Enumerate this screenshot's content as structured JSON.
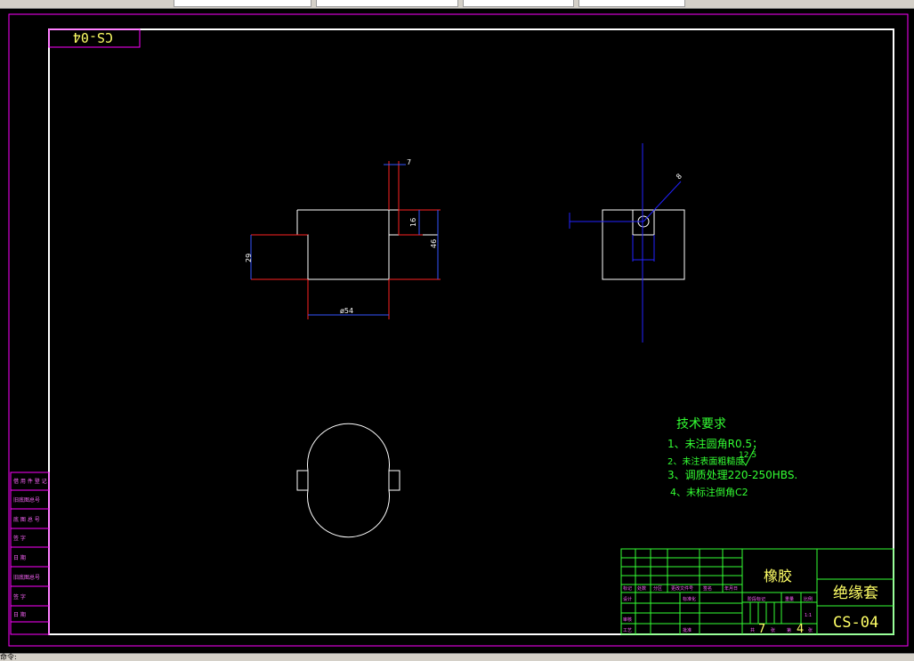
{
  "toolbar": {
    "tabs": [
      "",
      "",
      "",
      ""
    ],
    "status_text": "命令:"
  },
  "drawing": {
    "label_top": "CS-04",
    "dimensions": {
      "d7": "7",
      "d16": "16",
      "d46": "46",
      "d29": "29",
      "d54": "ø54",
      "d8": "8"
    },
    "tech_requirements": {
      "title": "技术要求",
      "items": [
        "1、未注圆角R0.5；",
        "2、未注表面粗糙度",
        "3、调质处理220-250HBS.",
        "4、未标注倒角C2"
      ],
      "roughness": "12.5"
    },
    "title_block": {
      "material": "橡胶",
      "part_name": "绝缘套",
      "drawing_no": "CS-04",
      "scale": "1:1",
      "sheet_total": "7",
      "sheet_no": "4",
      "header_labels": [
        "标记",
        "处数",
        "分区",
        "更改文件号",
        "签名",
        "年月日"
      ],
      "row_labels": [
        "设计",
        "审核",
        "工艺"
      ],
      "std_label": "标准化",
      "approve_label": "批准",
      "stage_labels": [
        "阶段标记",
        "重量",
        "比例"
      ],
      "sheet_total_label": "共",
      "sheet_total_unit": "张",
      "sheet_no_label": "第",
      "sheet_no_unit": "张"
    },
    "side_labels": [
      "借 用 件 登 记",
      "旧底图总号",
      "底 图 总 号",
      "签 字",
      "日 期",
      "旧底图总号",
      "签 字",
      "日 期"
    ]
  }
}
